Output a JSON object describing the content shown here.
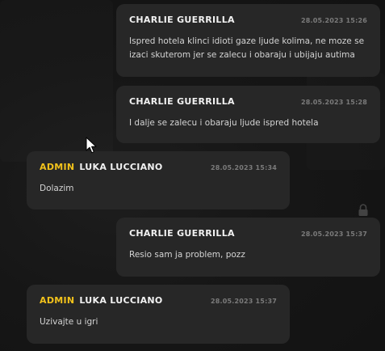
{
  "messages": [
    {
      "side": "mine",
      "role": "",
      "author": "CHARLIE GUERRILLA",
      "time": "28.05.2023 15:26",
      "text": "Ispred hotela klinci idioti gaze ljude kolima, ne moze se izaci skuterom jer se zalecu i obaraju i ubijaju autima"
    },
    {
      "side": "mine",
      "role": "",
      "author": "CHARLIE GUERRILLA",
      "time": "28.05.2023 15:28",
      "text": "I dalje se zalecu i obaraju ljude ispred hotela"
    },
    {
      "side": "other",
      "role": "ADMIN",
      "author": "LUKA LUCCIANO",
      "time": "28.05.2023 15:34",
      "text": "Dolazim"
    },
    {
      "side": "mine",
      "role": "",
      "author": "CHARLIE GUERRILLA",
      "time": "28.05.2023 15:37",
      "text": "Resio sam ja problem, pozz"
    },
    {
      "side": "other",
      "role": "ADMIN",
      "author": "LUKA LUCCIANO",
      "time": "28.05.2023 15:37",
      "text": "Uzivajte u igri"
    }
  ],
  "colors": {
    "background": "#151515",
    "bubble": "#272727",
    "admin_accent": "#f2c21b",
    "author": "#f1f1f1",
    "timestamp": "#7b7b7b",
    "text": "#d4d4d4"
  },
  "icons": {
    "cursor": "mouse-cursor-icon",
    "lock": "lock-icon"
  }
}
